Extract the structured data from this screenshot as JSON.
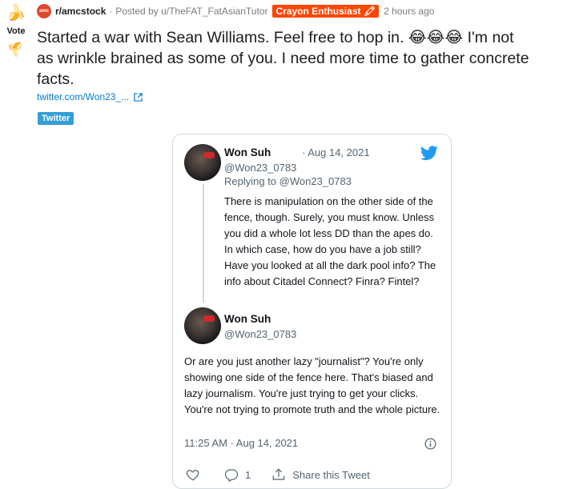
{
  "vote": {
    "label": "Vote",
    "up_icon": "banana-up-icon",
    "down_icon": "banana-down-icon"
  },
  "post": {
    "subreddit_icon_text": "amc",
    "subreddit": "r/amcstock",
    "posted_by": "Posted by u/TheFAT_FatAsianTutor",
    "flair": "Crayon Enthusiast 🖍",
    "time": "2 hours ago",
    "title": "Started a war with Sean Williams. Feel free to hop in. 😂😂😂 I'm not as wrinkle brained as some of you. I need more time to gather concrete facts.",
    "link_text": "twitter.com/Won23_...",
    "domain_tag": "Twitter"
  },
  "tweet": {
    "reply": {
      "name": "Won Suh",
      "date": "· Aug 14, 2021",
      "handle": "@Won23_0783",
      "replying_to": "Replying to @Won23_0783",
      "text": "There is manipulation on the other side of the fence, though. Surely, you must know. Unless you did a whole lot less DD than the apes do. In which case, how do you have a job still? Have you looked at all the dark pool info? The info about Citadel Connect? Finra? Fintel?"
    },
    "main": {
      "name": "Won Suh",
      "handle": "@Won23_0783",
      "text": "Or are you just another lazy \"journalist\"? You're only showing one side of the fence here. That's biased and lazy journalism. You're just trying to get your clicks. You're not trying to promote truth and the whole picture.",
      "timestamp": "11:25 AM · Aug 14, 2021"
    },
    "actions": {
      "reply_count": "1",
      "share_label": "Share this Tweet"
    }
  },
  "colors": {
    "flair_bg": "#ff4500",
    "link": "#0079d3",
    "twitter_tag": "#349ed7",
    "twitter_blue": "#1d9bf0"
  }
}
